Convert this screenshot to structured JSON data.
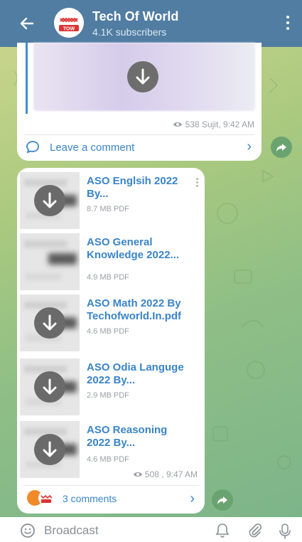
{
  "header": {
    "back_icon": "back-arrow-icon",
    "avatar_text": "TOW",
    "title": "Tech Of World",
    "subtitle": "4.1K subscribers",
    "menu_icon": "more-vert-icon"
  },
  "post1": {
    "views": "538",
    "author_time": "Sujit, 9:42 AM",
    "comment_label": "Leave a comment"
  },
  "post2": {
    "files": [
      {
        "name": "ASO Englsih 2022 By...",
        "size": "8.7 MB PDF"
      },
      {
        "name": "ASO General Knowledge 2022...",
        "size": "4.9 MB PDF"
      },
      {
        "name": "ASO Math 2022 By Techofworld.In.pdf",
        "size": "4.6 MB PDF"
      },
      {
        "name": "ASO Odia Languge 2022 By...",
        "size": "2.9 MB PDF"
      },
      {
        "name": "ASO Reasoning 2022 By...",
        "size": "4.6 MB PDF"
      }
    ],
    "views": "508",
    "time": ", 9:47 AM",
    "comments_label": "3 comments"
  },
  "bottom": {
    "placeholder": "Broadcast"
  },
  "colors": {
    "header": "#517da2",
    "link": "#3a84c8",
    "share_button": "#6aa36f"
  }
}
